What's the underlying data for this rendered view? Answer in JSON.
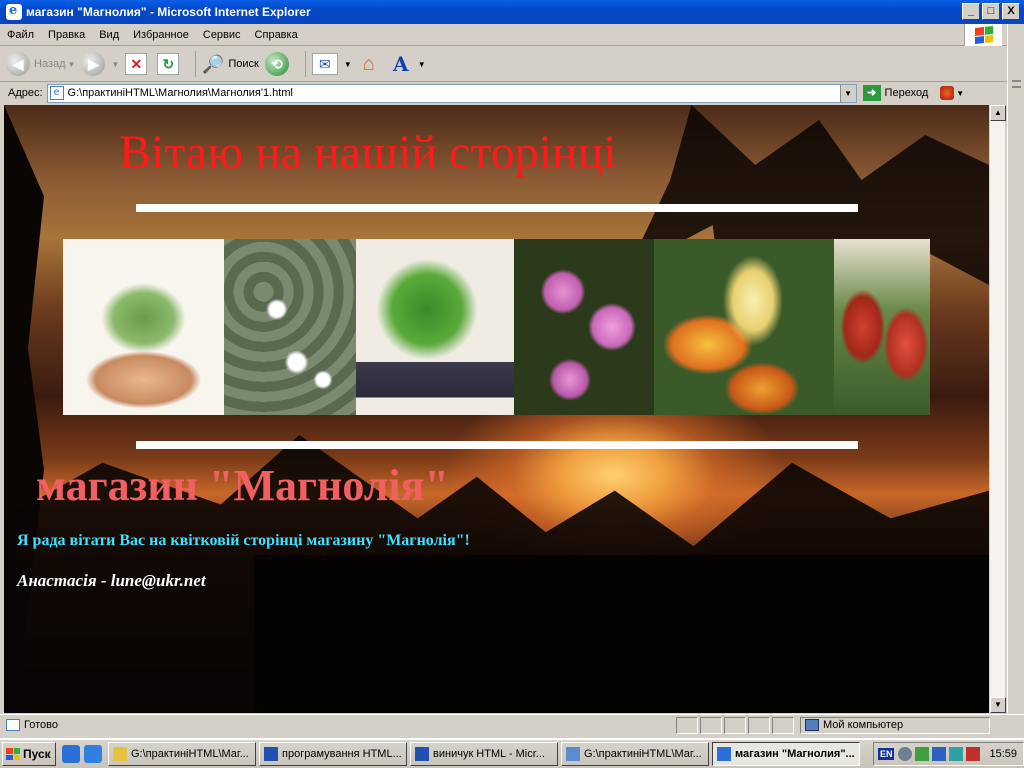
{
  "window": {
    "title": "магазин \"Магнолия\" - Microsoft Internet Explorer",
    "minimize": "_",
    "maximize": "□",
    "close": "X"
  },
  "menu": [
    "Файл",
    "Правка",
    "Вид",
    "Избранное",
    "Сервис",
    "Справка"
  ],
  "toolbar": {
    "back_label": "Назад",
    "search_label": "Поиск"
  },
  "address": {
    "label": "Адрес:",
    "url": "G:\\практиніHTML\\Магнолия\\Магнолия'1.html",
    "go_label": "Переход"
  },
  "page": {
    "greeting": "Вітаю на нашій сторінці",
    "shop_title": "магазин \"Магнолія\"",
    "welcome": "Я рада вітати Вас на квітковій сторінці магазину \"Магнолія\"!",
    "author": "Анастасія - lune@ukr.net",
    "photos": [
      {
        "name": "cactus-bowl-photo"
      },
      {
        "name": "lithops-flowers-photo"
      },
      {
        "name": "potted-plant-photo"
      },
      {
        "name": "pink-orchid-photo"
      },
      {
        "name": "slipper-orchid-photo"
      },
      {
        "name": "bromeliad-photo"
      }
    ]
  },
  "status": {
    "text": "Готово",
    "zone": "Мой компьютер"
  },
  "taskbar": {
    "start": "Пуск",
    "tasks": [
      {
        "label": "G:\\практиніHTML\\Маг...",
        "active": false
      },
      {
        "label": "програмування HTML...",
        "active": false
      },
      {
        "label": "виничук   HTML - Micr...",
        "active": false
      },
      {
        "label": "G:\\практиніHTML\\Маг...",
        "active": false
      },
      {
        "label": "магазин \"Магнолия\"...",
        "active": true
      }
    ],
    "lang": "EN",
    "clock": "15:59"
  }
}
